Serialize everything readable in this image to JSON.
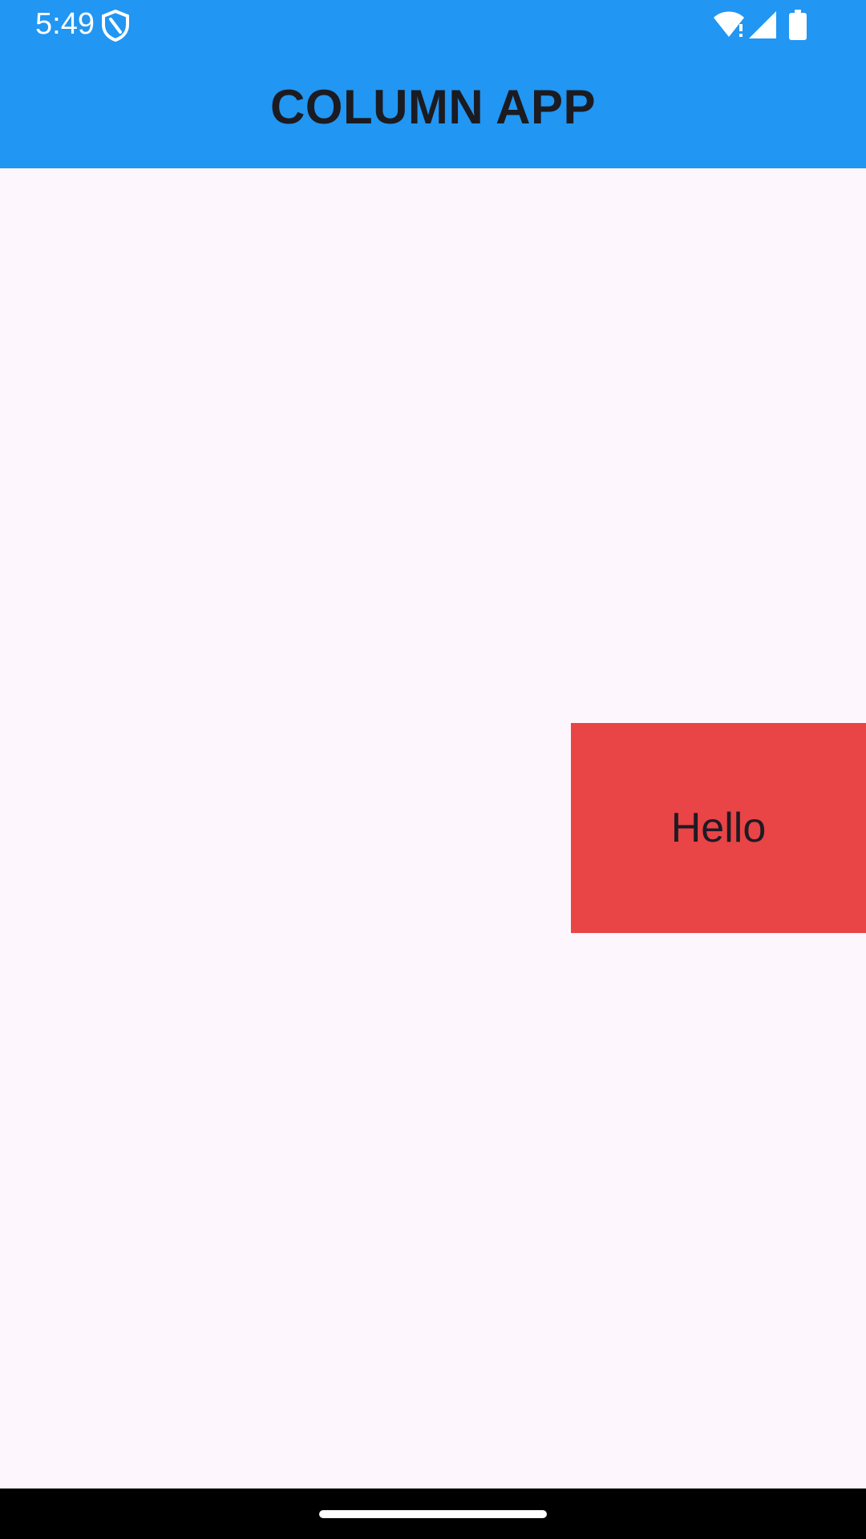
{
  "status_bar": {
    "time": "5:49",
    "icons": [
      "shield-icon",
      "wifi-icon",
      "signal-icon",
      "battery-icon"
    ]
  },
  "app_bar": {
    "title": "COLUMN APP",
    "color": "#2196F3"
  },
  "content": {
    "box_label": "Hello",
    "box_color": "#E94446",
    "background": "#FDF6FD"
  },
  "nav_bar": {
    "handle": "home-handle"
  }
}
